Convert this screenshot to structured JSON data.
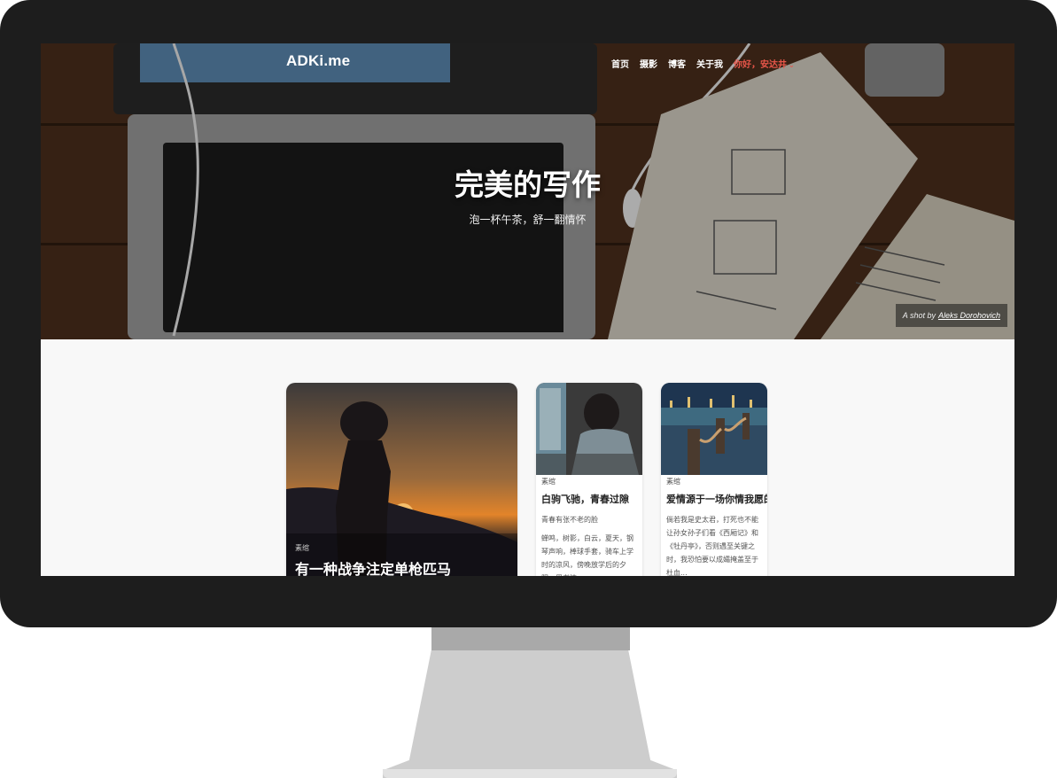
{
  "site": {
    "logo": "ADKi.me",
    "nav": [
      {
        "label": "首页"
      },
      {
        "label": "摄影"
      },
      {
        "label": "博客"
      },
      {
        "label": "关于我"
      },
      {
        "label": "你好，安达井"
      }
    ]
  },
  "hero": {
    "title": "完美的写作",
    "subtitle": "泡一杯午茶，舒一翻情怀",
    "credit_prefix": "A shot by",
    "credit_author": "Aleks Dorohovich"
  },
  "posts": [
    {
      "category": "素绾",
      "title": "有一种战争注定单枪匹马"
    },
    {
      "category": "素绾",
      "title": "白驹飞驰，青春过隙",
      "excerpt_lead": "青春有张不老的脸",
      "excerpt": "蝉鸣，树影，白云，夏天，钢琴声响，棒球手套，骑车上学时的凉风，傍晚放学后的夕阳，周书情"
    },
    {
      "category": "素绾",
      "title": "爱情源于一场你情我愿的",
      "excerpt": "倘若我是史太君，打死也不能让孙女孙子们看《西厢记》和《牡丹亭》，否则遇至关键之时，我恐怕要以成孀掩盖至于杜血..."
    }
  ],
  "colors": {
    "bezel": "#1d1d1d",
    "accent": "#e8564a",
    "page_background": "#f8f8f8"
  }
}
